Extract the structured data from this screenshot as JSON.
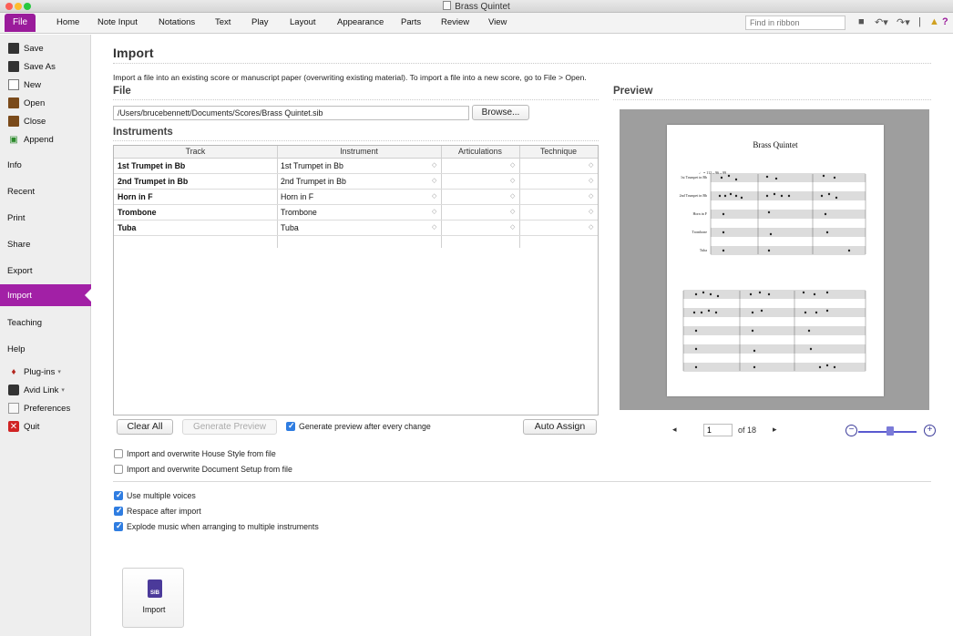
{
  "window": {
    "title": "Brass Quintet"
  },
  "ribbon": {
    "file": "File",
    "tabs": [
      "Home",
      "Note Input",
      "Notations",
      "Text",
      "Play",
      "Layout",
      "Appearance",
      "Parts",
      "Review",
      "View"
    ],
    "find_placeholder": "Find in ribbon"
  },
  "sidebar": {
    "save": "Save",
    "save_as": "Save As",
    "new": "New",
    "open": "Open",
    "close": "Close",
    "append": "Append",
    "info": "Info",
    "recent": "Recent",
    "print": "Print",
    "share": "Share",
    "export": "Export",
    "import": "Import",
    "teaching": "Teaching",
    "help": "Help",
    "plugins": "Plug-ins",
    "avid_link": "Avid Link",
    "preferences": "Preferences",
    "quit": "Quit"
  },
  "main": {
    "title": "Import",
    "description": "Import a file into an existing score or manuscript paper (overwriting existing material). To import a file into a new score, go to File > Open.",
    "file_heading": "File",
    "file_path": "/Users/brucebennett/Documents/Scores/Brass Quintet.sib",
    "browse": "Browse...",
    "instruments_heading": "Instruments",
    "preview_heading": "Preview",
    "columns": [
      "Track",
      "Instrument",
      "Articulations",
      "Technique"
    ],
    "rows": [
      {
        "track": "1st Trumpet in Bb",
        "instrument": "1st Trumpet in Bb"
      },
      {
        "track": "2nd Trumpet in Bb",
        "instrument": "2nd Trumpet in Bb"
      },
      {
        "track": "Horn in F",
        "instrument": "Horn in F"
      },
      {
        "track": "Trombone",
        "instrument": "Trombone"
      },
      {
        "track": "Tuba",
        "instrument": "Tuba"
      }
    ],
    "clear_all": "Clear All",
    "generate_preview": "Generate Preview",
    "generate_after_change": "Generate preview after every change",
    "auto_assign": "Auto Assign",
    "house_style": "Import and overwrite House Style from file",
    "document_setup": "Import and overwrite Document Setup from file",
    "multiple_voices": "Use multiple voices",
    "respace": "Respace after import",
    "explode": "Explode music when arranging to multiple instruments",
    "import_button": "Import"
  },
  "preview": {
    "page_title": "Brass Quintet",
    "tempo": "♩ = 112 – 96 – 99",
    "staff_names": [
      "1st Trumpet in Bb",
      "2nd Trumpet in Bb",
      "Horn in F",
      "Trombone",
      "Tuba"
    ],
    "page_number": "1",
    "page_of": "of 18"
  },
  "checkboxes": {
    "generate_after_change": true,
    "house_style": false,
    "document_setup": false,
    "multiple_voices": true,
    "respace": true,
    "explode": true
  },
  "colors": {
    "accent": "#a220a6",
    "checkbox": "#2f7de1"
  }
}
